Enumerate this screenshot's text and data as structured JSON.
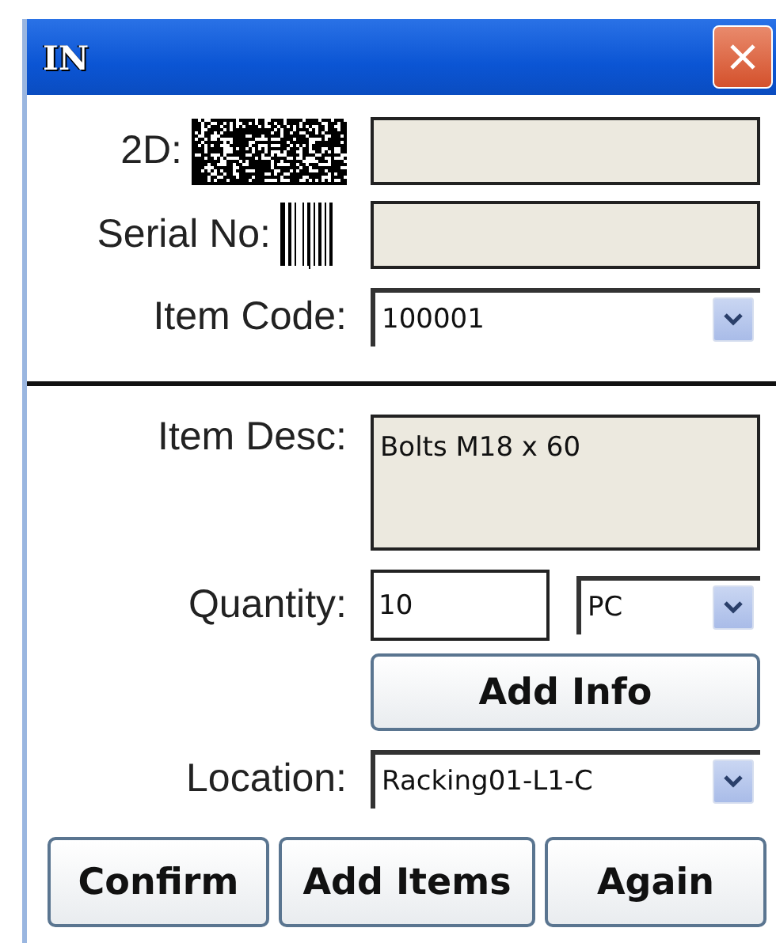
{
  "window": {
    "title": "IN"
  },
  "top_rows": [
    {
      "kind": "matrix-scan",
      "label": "2D:"
    },
    {
      "kind": "barcode-scan",
      "label": "Serial No:"
    },
    {
      "kind": "combo",
      "label": "Item Code:",
      "value": "100001"
    }
  ],
  "bottom_rows": [
    {
      "kind": "memo",
      "label": "Item Desc:",
      "value": "Bolts M18 x 60"
    },
    {
      "kind": "quantity",
      "label": "Quantity:",
      "value": "10",
      "unit": "PC"
    },
    {
      "kind": "button",
      "label": "Add Info"
    },
    {
      "kind": "combo",
      "label": "Location:",
      "value": "Racking01-L1-C"
    }
  ],
  "buttons": [
    "Confirm",
    "Add Items",
    "Again"
  ]
}
